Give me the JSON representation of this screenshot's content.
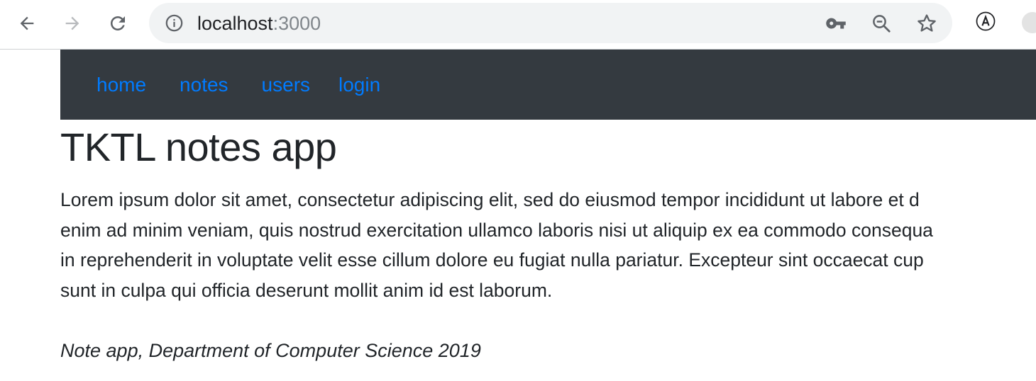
{
  "browser": {
    "url_host": "localhost",
    "url_port": ":3000",
    "toolbar_icons": [
      "back-arrow-icon",
      "forward-arrow-icon",
      "reload-icon",
      "info-icon",
      "key-icon",
      "zoom-out-icon",
      "star-icon",
      "translate-extension-icon"
    ]
  },
  "navbar": {
    "links": [
      {
        "label": "home"
      },
      {
        "label": "notes"
      },
      {
        "label": "users"
      },
      {
        "label": "login"
      }
    ]
  },
  "main": {
    "title": "TKTL notes app",
    "paragraph_lines": [
      "Lorem ipsum dolor sit amet, consectetur adipiscing elit, sed do eiusmod tempor incididunt ut labore et d",
      "enim ad minim veniam, quis nostrud exercitation ullamco laboris nisi ut aliquip ex ea commodo consequa",
      "in reprehenderit in voluptate velit esse cillum dolore eu fugiat nulla pariatur. Excepteur sint occaecat cup",
      "sunt in culpa qui officia deserunt mollit anim id est laborum."
    ],
    "footer": "Note app, Department of Computer Science 2019"
  },
  "colors": {
    "navbar_bg": "#343a40",
    "link": "#007bff",
    "text": "#212529",
    "omnibox_bg": "#f1f3f4"
  }
}
